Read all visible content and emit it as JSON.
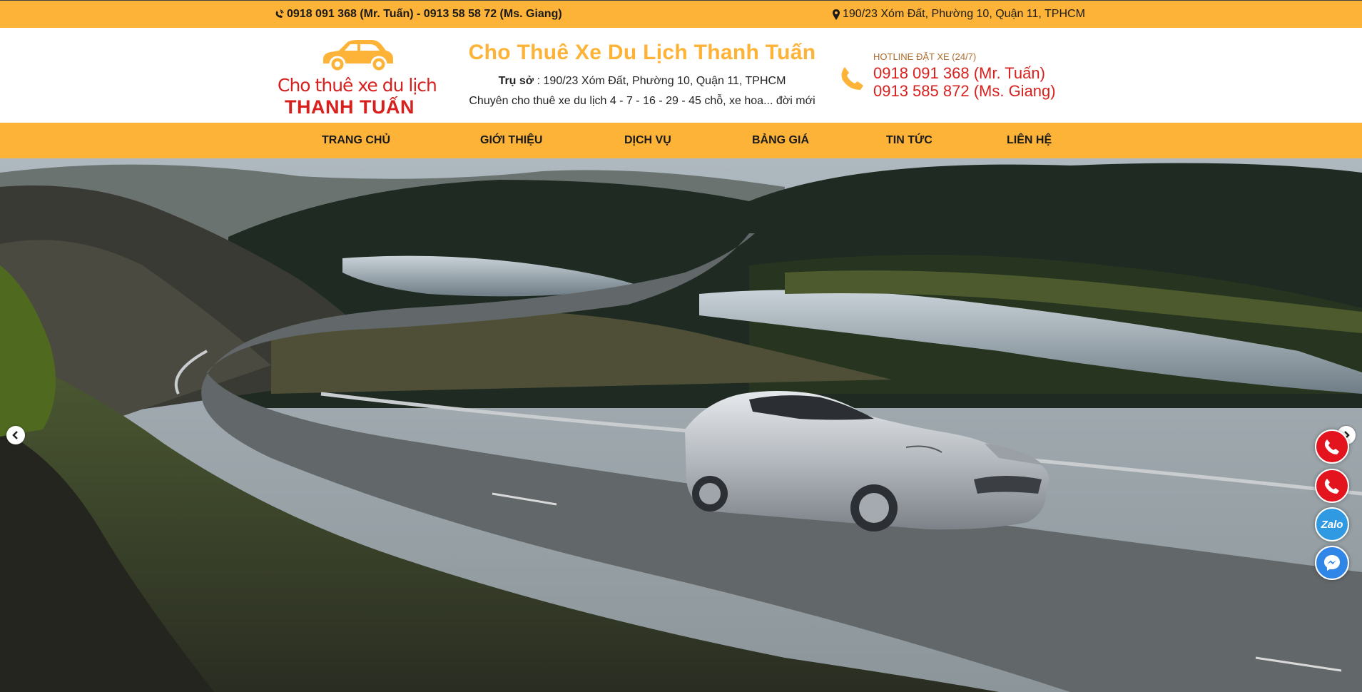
{
  "topbar": {
    "phones": "0918 091 368 (Mr. Tuấn) - 0913 58 58 72 (Ms. Giang)",
    "address": "190/23 Xóm Đất, Phường 10, Quận 11, TPHCM"
  },
  "logo": {
    "line1": "Cho thuê xe du lịch",
    "line2": "THANH TUẤN"
  },
  "header": {
    "brand": "Cho Thuê Xe Du Lịch Thanh Tuấn",
    "office_label": "Trụ sở",
    "office_value": ": 190/23 Xóm Đất, Phường 10, Quận 11, TPHCM",
    "slogan": "Chuyên cho thuê xe du lịch 4 - 7 - 16 - 29 - 45 chỗ, xe hoa... đời mới"
  },
  "hotline": {
    "label": "HOTLINE ĐẶT XE (24/7)",
    "number1": "0918 091 368 (Mr. Tuấn)",
    "number2": "0913 585 872 (Ms. Giang)"
  },
  "nav": {
    "items": [
      {
        "label": "TRANG CHỦ"
      },
      {
        "label": "GIỚI THIỆU"
      },
      {
        "label": "DỊCH VỤ"
      },
      {
        "label": "BẢNG GIÁ"
      },
      {
        "label": "TIN TỨC"
      },
      {
        "label": "LIÊN HỆ"
      }
    ]
  },
  "floating": {
    "zalo_label": "Zalo"
  },
  "colors": {
    "accent": "#fdb337",
    "brand_red": "#d8201f"
  },
  "icons": [
    "phone-volume-icon",
    "map-marker-icon",
    "phone-icon",
    "chevron-left-icon",
    "chevron-right-icon",
    "messenger-icon",
    "car-icon"
  ]
}
